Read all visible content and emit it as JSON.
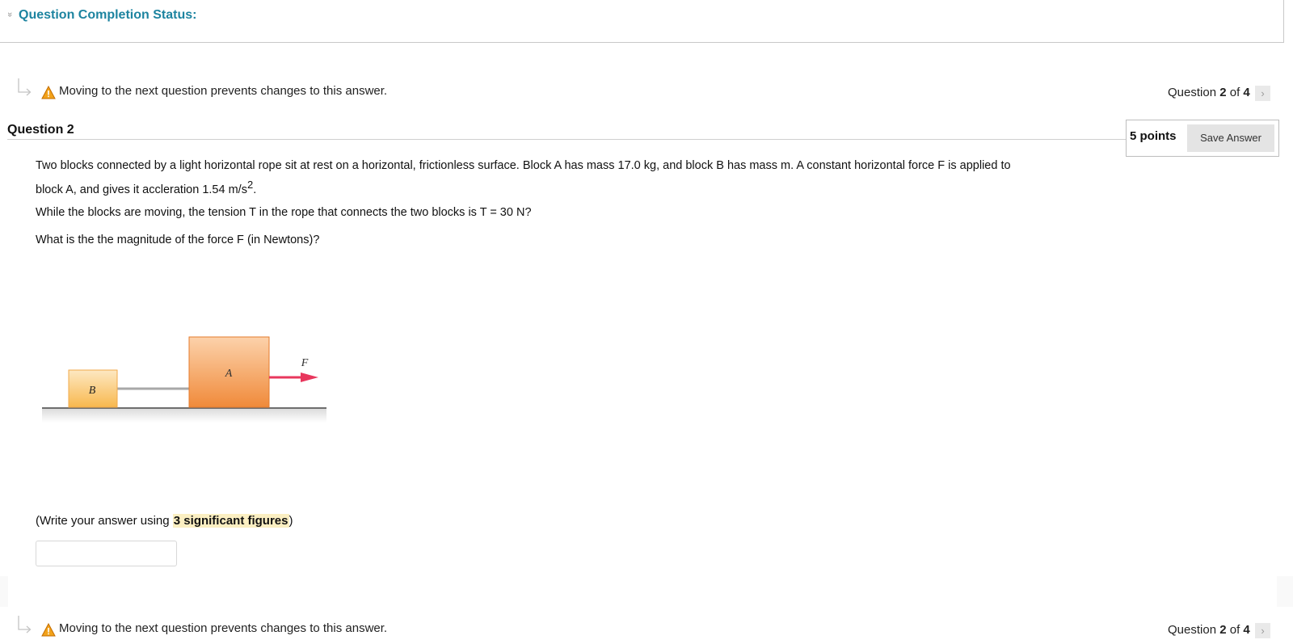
{
  "status": {
    "chevron": "»",
    "title": "Question Completion Status:"
  },
  "navigation": {
    "warning": "Moving to the next question prevents changes to this answer.",
    "question_prefix": "Question",
    "current": "2",
    "of_label": "of",
    "total": "4",
    "next_symbol": "›"
  },
  "question": {
    "heading": "Question 2",
    "points": "5 points",
    "save_label": "Save Answer",
    "paragraph1_line1": "Two blocks connected by a light horizontal rope sit at rest on a horizontal, frictionless surface. Block A has mass 17.0 kg, and block B has mass m. A constant horizontal force F is applied to",
    "paragraph1_line2_before": "block A, and gives it accleration 1.54 m/s",
    "paragraph1_sup": "2",
    "paragraph1_after": ".",
    "paragraph2": "While the blocks are moving, the tension T in the rope that connects the two blocks is T = 30 N?",
    "paragraph3": "What is the the magnitude of the force F (in Newtons)?",
    "figure": {
      "block_b_label": "B",
      "block_a_label": "A",
      "force_label": "F",
      "colors": {
        "block_b_top": "#fde8c2",
        "block_b_bottom": "#f8b84e",
        "block_a_top": "#fcd2ab",
        "block_a_bottom": "#f08a3a",
        "force_arrow": "#e8375d"
      }
    },
    "hint_before": "(Write your answer using ",
    "hint_strong": "3 significant figures",
    "hint_after": ")",
    "answer_value": ""
  },
  "colors": {
    "accent": "#1d84a0",
    "warning_icon": "#f2a21a"
  }
}
